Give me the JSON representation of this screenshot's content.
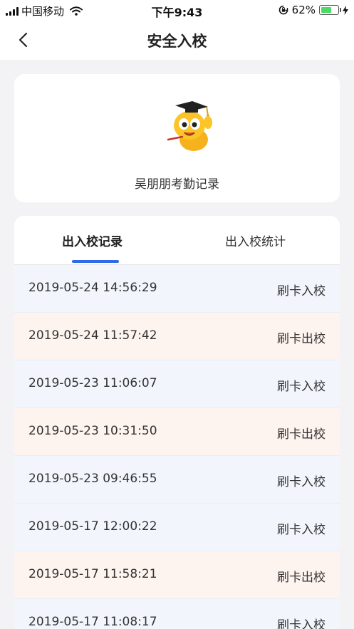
{
  "status_bar": {
    "carrier": "中国移动",
    "time": "下午9:43",
    "battery_percent": "62%",
    "battery_level": 0.62,
    "icons": [
      "signal-icon",
      "wifi-icon",
      "orientation-lock-icon",
      "battery-icon",
      "charging-icon"
    ]
  },
  "nav": {
    "title": "安全入校",
    "back_icon": "chevron-left-icon"
  },
  "profile": {
    "name_label": "吴朋朋考勤记录",
    "mascot_icon": "graduate-mascot-icon"
  },
  "tabs": {
    "items": [
      {
        "label": "出入校记录",
        "active": true
      },
      {
        "label": "出入校统计",
        "active": false
      }
    ]
  },
  "records": [
    {
      "time": "2019-05-24 14:56:29",
      "action": "刷卡入校",
      "type": "in"
    },
    {
      "time": "2019-05-24 11:57:42",
      "action": "刷卡出校",
      "type": "out"
    },
    {
      "time": "2019-05-23 11:06:07",
      "action": "刷卡入校",
      "type": "in"
    },
    {
      "time": "2019-05-23 10:31:50",
      "action": "刷卡出校",
      "type": "out"
    },
    {
      "time": "2019-05-23 09:46:55",
      "action": "刷卡入校",
      "type": "in"
    },
    {
      "time": "2019-05-17 12:00:22",
      "action": "刷卡入校",
      "type": "in"
    },
    {
      "time": "2019-05-17 11:58:21",
      "action": "刷卡出校",
      "type": "out"
    },
    {
      "time": "2019-05-17 11:08:17",
      "action": "刷卡入校",
      "type": "in"
    }
  ],
  "colors": {
    "accent": "#2f6be6",
    "in_row_bg": "#f2f6fc",
    "out_row_bg": "#fdf3ef",
    "page_bg": "#f3f3f5"
  }
}
